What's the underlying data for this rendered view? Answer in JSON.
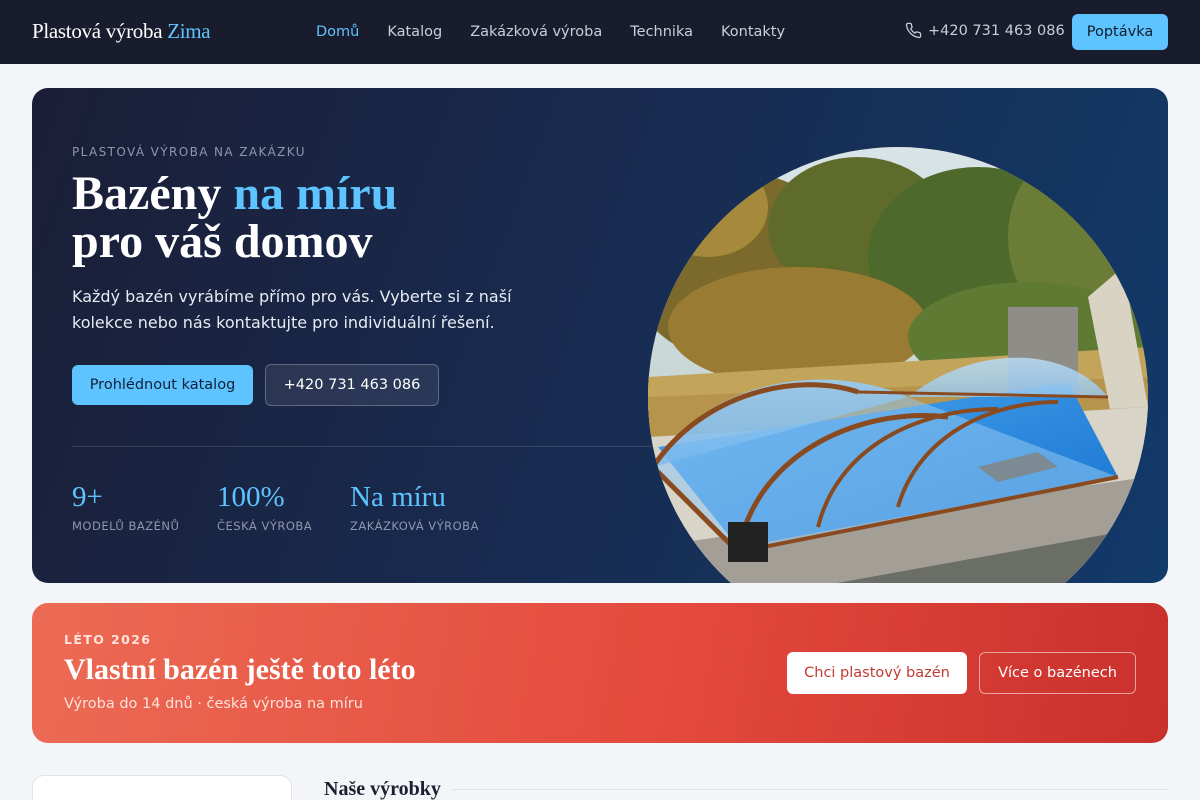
{
  "header": {
    "brand_main": "Plastová výroba",
    "brand_accent": "Zima",
    "nav": [
      {
        "label": "Domů",
        "active": true
      },
      {
        "label": "Katalog",
        "active": false
      },
      {
        "label": "Zakázková výroba",
        "active": false
      },
      {
        "label": "Technika",
        "active": false
      },
      {
        "label": "Kontakty",
        "active": false
      }
    ],
    "phone": "+420 731 463 086",
    "phone_icon": "phone-icon",
    "cta_label": "Poptávka"
  },
  "hero": {
    "eyebrow": "PLASTOVÁ VÝROBA NA ZAKÁZKU",
    "title_line1_main": "Bazény",
    "title_line1_accent": "na míru",
    "title_line2": "pro váš domov",
    "description": "Každý bazén vyrábíme přímo pro vás. Vyberte si z naší kolekce nebo nás kontaktujte pro individuální řešení.",
    "primary_button": "Prohlédnout katalog",
    "secondary_button": "+420 731 463 086",
    "stats": [
      {
        "value": "9+",
        "label": "MODELŮ BAZÉNŮ"
      },
      {
        "value": "100%",
        "label": "ČESKÁ VÝROBA"
      },
      {
        "value": "Na míru",
        "label": "ZAKÁZKOVÁ VÝROBA"
      }
    ],
    "image": "pool-with-enclosure-photo"
  },
  "promo": {
    "eyebrow": "LÉTO 2026",
    "title": "Vlastní bazén ještě toto léto",
    "subtitle": "Výroba do 14 dnů · česká výroba na míru",
    "primary_button": "Chci plastový bazén",
    "secondary_button": "Více o bazénech"
  },
  "products": {
    "section_title": "Naše výrobky"
  },
  "colors": {
    "accent": "#5ec4ff",
    "header_bg": "#191c2c",
    "promo_red": "#e44a3d"
  }
}
